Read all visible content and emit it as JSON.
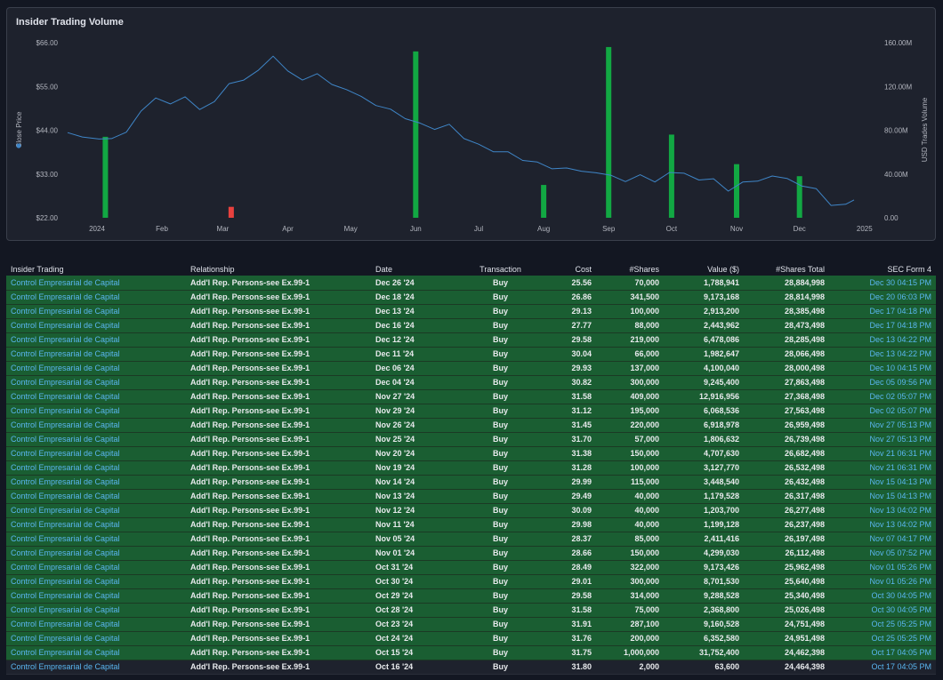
{
  "chart_data": {
    "type": "bar",
    "title": "Insider Trading Volume",
    "ylabel_left": "Close Price",
    "ylabel_right": "USD Trades Volume",
    "x_ticks": [
      "2024",
      "Feb",
      "Mar",
      "Apr",
      "May",
      "Jun",
      "Jul",
      "Aug",
      "Sep",
      "Oct",
      "Nov",
      "Dec",
      "2025"
    ],
    "y_left_ticks": [
      "$66.00",
      "$55.00",
      "$44.00",
      "$33.00",
      "$22.00"
    ],
    "y_right_ticks": [
      "160.00M",
      "120.00M",
      "80.00M",
      "40.00M",
      "0.00"
    ],
    "ylim_left": [
      22,
      66
    ],
    "ylim_right": [
      0,
      160
    ],
    "x_range": [
      "2023-12-18",
      "2025-01-10"
    ],
    "legend": "left",
    "series_colors": {
      "price": "#3f86c8",
      "buy": "#12a843",
      "sell": "#e8413e"
    },
    "volume_bars": [
      {
        "date": "2024-01-05",
        "value_m": 74,
        "side": "buy"
      },
      {
        "date": "2024-03-05",
        "value_m": 10,
        "side": "sell"
      },
      {
        "date": "2024-06-01",
        "value_m": 152,
        "side": "buy"
      },
      {
        "date": "2024-08-01",
        "value_m": 30,
        "side": "buy"
      },
      {
        "date": "2024-09-01",
        "value_m": 156,
        "side": "buy"
      },
      {
        "date": "2024-10-01",
        "value_m": 76,
        "side": "buy"
      },
      {
        "date": "2024-11-01",
        "value_m": 49,
        "side": "buy"
      },
      {
        "date": "2024-12-01",
        "value_m": 38,
        "side": "buy"
      }
    ],
    "price_series": [
      [
        "2023-12-18",
        43.4
      ],
      [
        "2023-12-25",
        42.3
      ],
      [
        "2024-01-02",
        41.8
      ],
      [
        "2024-01-08",
        41.9
      ],
      [
        "2024-01-15",
        43.5
      ],
      [
        "2024-01-22",
        48.8
      ],
      [
        "2024-01-29",
        52.1
      ],
      [
        "2024-02-05",
        50.6
      ],
      [
        "2024-02-12",
        52.4
      ],
      [
        "2024-02-19",
        49.2
      ],
      [
        "2024-02-26",
        51.2
      ],
      [
        "2024-03-04",
        55.7
      ],
      [
        "2024-03-11",
        56.6
      ],
      [
        "2024-03-18",
        59.1
      ],
      [
        "2024-03-25",
        62.6
      ],
      [
        "2024-04-01",
        58.9
      ],
      [
        "2024-04-08",
        56.6
      ],
      [
        "2024-04-15",
        58.2
      ],
      [
        "2024-04-22",
        55.5
      ],
      [
        "2024-04-29",
        54.2
      ],
      [
        "2024-05-06",
        52.5
      ],
      [
        "2024-05-13",
        50.2
      ],
      [
        "2024-05-20",
        49.3
      ],
      [
        "2024-05-27",
        46.9
      ],
      [
        "2024-06-03",
        45.8
      ],
      [
        "2024-06-10",
        44.2
      ],
      [
        "2024-06-17",
        45.5
      ],
      [
        "2024-06-24",
        41.9
      ],
      [
        "2024-07-01",
        40.5
      ],
      [
        "2024-07-08",
        38.6
      ],
      [
        "2024-07-15",
        38.6
      ],
      [
        "2024-07-22",
        36.4
      ],
      [
        "2024-07-29",
        36.0
      ],
      [
        "2024-08-05",
        34.3
      ],
      [
        "2024-08-12",
        34.5
      ],
      [
        "2024-08-19",
        33.7
      ],
      [
        "2024-08-26",
        33.3
      ],
      [
        "2024-09-02",
        32.7
      ],
      [
        "2024-09-09",
        31.1
      ],
      [
        "2024-09-16",
        32.8
      ],
      [
        "2024-09-23",
        31.0
      ],
      [
        "2024-09-30",
        33.4
      ],
      [
        "2024-10-07",
        33.2
      ],
      [
        "2024-10-14",
        31.5
      ],
      [
        "2024-10-21",
        31.8
      ],
      [
        "2024-10-28",
        28.7
      ],
      [
        "2024-11-04",
        31.0
      ],
      [
        "2024-11-11",
        31.2
      ],
      [
        "2024-11-18",
        32.5
      ],
      [
        "2024-11-25",
        31.9
      ],
      [
        "2024-12-02",
        30.0
      ],
      [
        "2024-12-09",
        29.3
      ],
      [
        "2024-12-16",
        25.1
      ],
      [
        "2024-12-23",
        25.4
      ],
      [
        "2024-12-27",
        26.5
      ]
    ]
  },
  "table": {
    "headers": {
      "name": "Insider Trading",
      "rel": "Relationship",
      "date": "Date",
      "txn": "Transaction",
      "cost": "Cost",
      "shares": "#Shares",
      "value": "Value ($)",
      "total": "#Shares Total",
      "form": "SEC Form 4"
    },
    "rows": [
      {
        "name": "Control Empresarial de Capital",
        "rel": "Add'l Rep. Persons-see Ex.99-1",
        "date": "Dec 26 '24",
        "txn": "Buy",
        "cost": "25.56",
        "shares": "70,000",
        "value": "1,788,941",
        "total": "28,884,998",
        "form": "Dec 30 04:15 PM"
      },
      {
        "name": "Control Empresarial de Capital",
        "rel": "Add'l Rep. Persons-see Ex.99-1",
        "date": "Dec 18 '24",
        "txn": "Buy",
        "cost": "26.86",
        "shares": "341,500",
        "value": "9,173,168",
        "total": "28,814,998",
        "form": "Dec 20 06:03 PM"
      },
      {
        "name": "Control Empresarial de Capital",
        "rel": "Add'l Rep. Persons-see Ex.99-1",
        "date": "Dec 13 '24",
        "txn": "Buy",
        "cost": "29.13",
        "shares": "100,000",
        "value": "2,913,200",
        "total": "28,385,498",
        "form": "Dec 17 04:18 PM"
      },
      {
        "name": "Control Empresarial de Capital",
        "rel": "Add'l Rep. Persons-see Ex.99-1",
        "date": "Dec 16 '24",
        "txn": "Buy",
        "cost": "27.77",
        "shares": "88,000",
        "value": "2,443,962",
        "total": "28,473,498",
        "form": "Dec 17 04:18 PM"
      },
      {
        "name": "Control Empresarial de Capital",
        "rel": "Add'l Rep. Persons-see Ex.99-1",
        "date": "Dec 12 '24",
        "txn": "Buy",
        "cost": "29.58",
        "shares": "219,000",
        "value": "6,478,086",
        "total": "28,285,498",
        "form": "Dec 13 04:22 PM"
      },
      {
        "name": "Control Empresarial de Capital",
        "rel": "Add'l Rep. Persons-see Ex.99-1",
        "date": "Dec 11 '24",
        "txn": "Buy",
        "cost": "30.04",
        "shares": "66,000",
        "value": "1,982,647",
        "total": "28,066,498",
        "form": "Dec 13 04:22 PM"
      },
      {
        "name": "Control Empresarial de Capital",
        "rel": "Add'l Rep. Persons-see Ex.99-1",
        "date": "Dec 06 '24",
        "txn": "Buy",
        "cost": "29.93",
        "shares": "137,000",
        "value": "4,100,040",
        "total": "28,000,498",
        "form": "Dec 10 04:15 PM"
      },
      {
        "name": "Control Empresarial de Capital",
        "rel": "Add'l Rep. Persons-see Ex.99-1",
        "date": "Dec 04 '24",
        "txn": "Buy",
        "cost": "30.82",
        "shares": "300,000",
        "value": "9,245,400",
        "total": "27,863,498",
        "form": "Dec 05 09:56 PM"
      },
      {
        "name": "Control Empresarial de Capital",
        "rel": "Add'l Rep. Persons-see Ex.99-1",
        "date": "Nov 27 '24",
        "txn": "Buy",
        "cost": "31.58",
        "shares": "409,000",
        "value": "12,916,956",
        "total": "27,368,498",
        "form": "Dec 02 05:07 PM"
      },
      {
        "name": "Control Empresarial de Capital",
        "rel": "Add'l Rep. Persons-see Ex.99-1",
        "date": "Nov 29 '24",
        "txn": "Buy",
        "cost": "31.12",
        "shares": "195,000",
        "value": "6,068,536",
        "total": "27,563,498",
        "form": "Dec 02 05:07 PM"
      },
      {
        "name": "Control Empresarial de Capital",
        "rel": "Add'l Rep. Persons-see Ex.99-1",
        "date": "Nov 26 '24",
        "txn": "Buy",
        "cost": "31.45",
        "shares": "220,000",
        "value": "6,918,978",
        "total": "26,959,498",
        "form": "Nov 27 05:13 PM"
      },
      {
        "name": "Control Empresarial de Capital",
        "rel": "Add'l Rep. Persons-see Ex.99-1",
        "date": "Nov 25 '24",
        "txn": "Buy",
        "cost": "31.70",
        "shares": "57,000",
        "value": "1,806,632",
        "total": "26,739,498",
        "form": "Nov 27 05:13 PM"
      },
      {
        "name": "Control Empresarial de Capital",
        "rel": "Add'l Rep. Persons-see Ex.99-1",
        "date": "Nov 20 '24",
        "txn": "Buy",
        "cost": "31.38",
        "shares": "150,000",
        "value": "4,707,630",
        "total": "26,682,498",
        "form": "Nov 21 06:31 PM"
      },
      {
        "name": "Control Empresarial de Capital",
        "rel": "Add'l Rep. Persons-see Ex.99-1",
        "date": "Nov 19 '24",
        "txn": "Buy",
        "cost": "31.28",
        "shares": "100,000",
        "value": "3,127,770",
        "total": "26,532,498",
        "form": "Nov 21 06:31 PM"
      },
      {
        "name": "Control Empresarial de Capital",
        "rel": "Add'l Rep. Persons-see Ex.99-1",
        "date": "Nov 14 '24",
        "txn": "Buy",
        "cost": "29.99",
        "shares": "115,000",
        "value": "3,448,540",
        "total": "26,432,498",
        "form": "Nov 15 04:13 PM"
      },
      {
        "name": "Control Empresarial de Capital",
        "rel": "Add'l Rep. Persons-see Ex.99-1",
        "date": "Nov 13 '24",
        "txn": "Buy",
        "cost": "29.49",
        "shares": "40,000",
        "value": "1,179,528",
        "total": "26,317,498",
        "form": "Nov 15 04:13 PM"
      },
      {
        "name": "Control Empresarial de Capital",
        "rel": "Add'l Rep. Persons-see Ex.99-1",
        "date": "Nov 12 '24",
        "txn": "Buy",
        "cost": "30.09",
        "shares": "40,000",
        "value": "1,203,700",
        "total": "26,277,498",
        "form": "Nov 13 04:02 PM"
      },
      {
        "name": "Control Empresarial de Capital",
        "rel": "Add'l Rep. Persons-see Ex.99-1",
        "date": "Nov 11 '24",
        "txn": "Buy",
        "cost": "29.98",
        "shares": "40,000",
        "value": "1,199,128",
        "total": "26,237,498",
        "form": "Nov 13 04:02 PM"
      },
      {
        "name": "Control Empresarial de Capital",
        "rel": "Add'l Rep. Persons-see Ex.99-1",
        "date": "Nov 05 '24",
        "txn": "Buy",
        "cost": "28.37",
        "shares": "85,000",
        "value": "2,411,416",
        "total": "26,197,498",
        "form": "Nov 07 04:17 PM"
      },
      {
        "name": "Control Empresarial de Capital",
        "rel": "Add'l Rep. Persons-see Ex.99-1",
        "date": "Nov 01 '24",
        "txn": "Buy",
        "cost": "28.66",
        "shares": "150,000",
        "value": "4,299,030",
        "total": "26,112,498",
        "form": "Nov 05 07:52 PM"
      },
      {
        "name": "Control Empresarial de Capital",
        "rel": "Add'l Rep. Persons-see Ex.99-1",
        "date": "Oct 31 '24",
        "txn": "Buy",
        "cost": "28.49",
        "shares": "322,000",
        "value": "9,173,426",
        "total": "25,962,498",
        "form": "Nov 01 05:26 PM"
      },
      {
        "name": "Control Empresarial de Capital",
        "rel": "Add'l Rep. Persons-see Ex.99-1",
        "date": "Oct 30 '24",
        "txn": "Buy",
        "cost": "29.01",
        "shares": "300,000",
        "value": "8,701,530",
        "total": "25,640,498",
        "form": "Nov 01 05:26 PM"
      },
      {
        "name": "Control Empresarial de Capital",
        "rel": "Add'l Rep. Persons-see Ex.99-1",
        "date": "Oct 29 '24",
        "txn": "Buy",
        "cost": "29.58",
        "shares": "314,000",
        "value": "9,288,528",
        "total": "25,340,498",
        "form": "Oct 30 04:05 PM"
      },
      {
        "name": "Control Empresarial de Capital",
        "rel": "Add'l Rep. Persons-see Ex.99-1",
        "date": "Oct 28 '24",
        "txn": "Buy",
        "cost": "31.58",
        "shares": "75,000",
        "value": "2,368,800",
        "total": "25,026,498",
        "form": "Oct 30 04:05 PM"
      },
      {
        "name": "Control Empresarial de Capital",
        "rel": "Add'l Rep. Persons-see Ex.99-1",
        "date": "Oct 23 '24",
        "txn": "Buy",
        "cost": "31.91",
        "shares": "287,100",
        "value": "9,160,528",
        "total": "24,751,498",
        "form": "Oct 25 05:25 PM"
      },
      {
        "name": "Control Empresarial de Capital",
        "rel": "Add'l Rep. Persons-see Ex.99-1",
        "date": "Oct 24 '24",
        "txn": "Buy",
        "cost": "31.76",
        "shares": "200,000",
        "value": "6,352,580",
        "total": "24,951,498",
        "form": "Oct 25 05:25 PM"
      },
      {
        "name": "Control Empresarial de Capital",
        "rel": "Add'l Rep. Persons-see Ex.99-1",
        "date": "Oct 15 '24",
        "txn": "Buy",
        "cost": "31.75",
        "shares": "1,000,000",
        "value": "31,752,400",
        "total": "24,462,398",
        "form": "Oct 17 04:05 PM"
      },
      {
        "name": "Control Empresarial de Capital",
        "rel": "Add'l Rep. Persons-see Ex.99-1",
        "date": "Oct 16 '24",
        "txn": "Buy",
        "cost": "31.80",
        "shares": "2,000",
        "value": "63,600",
        "total": "24,464,398",
        "form": "Oct 17 04:05 PM"
      }
    ]
  }
}
